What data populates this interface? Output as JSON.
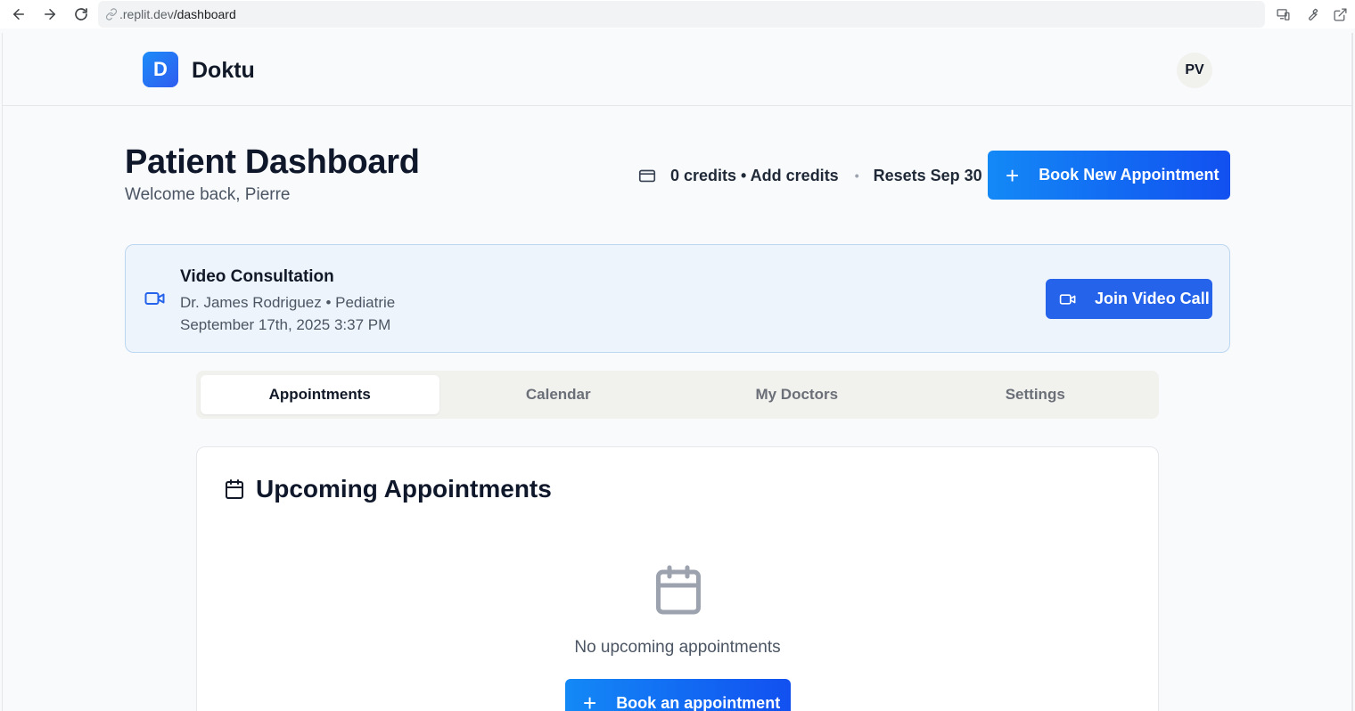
{
  "browser": {
    "url_host": ".replit.dev",
    "url_path": "/dashboard",
    "icons": [
      "back-arrow-icon",
      "forward-arrow-icon",
      "reload-icon",
      "link-icon",
      "devices-icon",
      "wrench-icon",
      "open-external-icon"
    ]
  },
  "header": {
    "logo_letter": "D",
    "app_name": "Doktu",
    "avatar_initials": "PV"
  },
  "page": {
    "title": "Patient Dashboard",
    "subtitle": "Welcome back, Pierre",
    "credits_text": "0 credits • Add credits",
    "separator": "•",
    "resets_text": "Resets Sep 30",
    "book_new_label": "Book New Appointment",
    "book_new_icon": "+"
  },
  "video_card": {
    "title": "Video Consultation",
    "doctor": "Dr. James Rodriguez • Pediatrie",
    "datetime": "September 17th, 2025 3:37 PM",
    "join_label": "Join Video Call",
    "accent_color": "#2563eb"
  },
  "tabs": [
    {
      "label": "Appointments",
      "active": true
    },
    {
      "label": "Calendar",
      "active": false
    },
    {
      "label": "My Doctors",
      "active": false
    },
    {
      "label": "Settings",
      "active": false
    }
  ],
  "appointments": {
    "heading": "Upcoming Appointments",
    "empty_text": "No upcoming appointments",
    "book_label": "Book an appointment",
    "book_icon": "+"
  },
  "colors": {
    "primary_gradient_start": "#1389f6",
    "primary_gradient_end": "#1250f0",
    "card_background": "#eef4fb"
  }
}
